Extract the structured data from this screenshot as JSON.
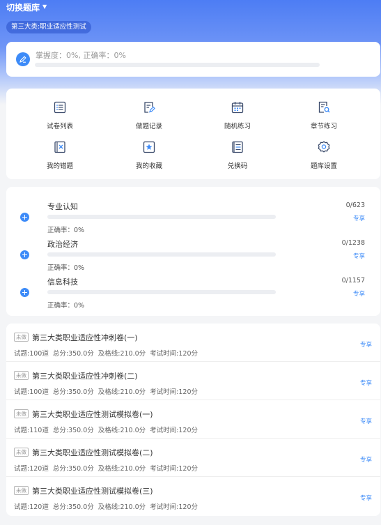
{
  "header": {
    "switch_label": "切换题库",
    "bank_name": "第三大类:职业适应性测试"
  },
  "mastery": {
    "label": "掌握度：0%, 正确率：0%",
    "progress": 0
  },
  "menu": {
    "items": [
      {
        "label": "试卷列表",
        "icon": "list-icon"
      },
      {
        "label": "做题记录",
        "icon": "record-icon"
      },
      {
        "label": "随机练习",
        "icon": "calendar-icon"
      },
      {
        "label": "章节练习",
        "icon": "search-doc-icon"
      },
      {
        "label": "我的错题",
        "icon": "wrong-book-icon"
      },
      {
        "label": "我的收藏",
        "icon": "star-icon"
      },
      {
        "label": "兑换码",
        "icon": "code-icon"
      },
      {
        "label": "题库设置",
        "icon": "gear-icon"
      }
    ]
  },
  "chapters": [
    {
      "name": "专业认知",
      "rate": "正确率：0%",
      "count": "0/623",
      "tag": "专享",
      "progress": 0
    },
    {
      "name": "政治经济",
      "rate": "正确率：0%",
      "count": "0/1238",
      "tag": "专享",
      "progress": 0
    },
    {
      "name": "信息科技",
      "rate": "正确率：0%",
      "count": "0/1157",
      "tag": "专享",
      "progress": 0
    }
  ],
  "papers": [
    {
      "status": "未做",
      "title": "第三大类职业适应性冲刺卷(一)",
      "questions": "试题:100道",
      "total": "总分:350.0分",
      "pass": "及格线:210.0分",
      "time": "考试时间:120分",
      "tag": "专享"
    },
    {
      "status": "未做",
      "title": "第三大类职业适应性冲刺卷(二)",
      "questions": "试题:100道",
      "total": "总分:350.0分",
      "pass": "及格线:210.0分",
      "time": "考试时间:120分",
      "tag": "专享"
    },
    {
      "status": "未做",
      "title": "第三大类职业适应性测试模拟卷(一)",
      "questions": "试题:110道",
      "total": "总分:350.0分",
      "pass": "及格线:210.0分",
      "time": "考试时间:120分",
      "tag": "专享"
    },
    {
      "status": "未做",
      "title": "第三大类职业适应性测试模拟卷(二)",
      "questions": "试题:120道",
      "total": "总分:350.0分",
      "pass": "及格线:210.0分",
      "time": "考试时间:120分",
      "tag": "专享"
    },
    {
      "status": "未做",
      "title": "第三大类职业适应性测试模拟卷(三)",
      "questions": "试题:120道",
      "total": "总分:350.0分",
      "pass": "及格线:210.0分",
      "time": "考试时间:120分",
      "tag": "专享"
    }
  ],
  "colors": {
    "accent": "#3d8bf8",
    "icon_stroke": "#3a4a6b",
    "header_blue": "#4d7df4"
  }
}
